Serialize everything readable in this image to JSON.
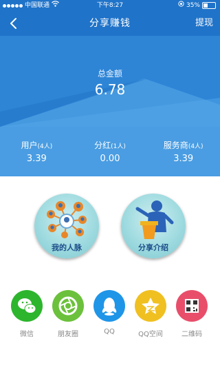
{
  "status_bar": {
    "carrier": "中国联通",
    "time": "下午8:27",
    "battery": "35%",
    "battery_level": 0.35
  },
  "nav": {
    "title": "分享赚钱",
    "right_action": "提现",
    "back_icon": "chevron-left-icon"
  },
  "summary": {
    "label": "总金额",
    "value": "6.78"
  },
  "stats": [
    {
      "name": "用户",
      "count": "(4人)",
      "value": "3.39"
    },
    {
      "name": "分红",
      "count": "(1人)",
      "value": "0.00"
    },
    {
      "name": "服务商",
      "count": "(4人)",
      "value": "3.39"
    }
  ],
  "actions": [
    {
      "label": "我的人脉",
      "icon": "network-people-icon"
    },
    {
      "label": "分享介绍",
      "icon": "presenter-icon"
    }
  ],
  "share_targets": [
    {
      "label": "微信",
      "icon": "wechat-icon",
      "color": "#2db52d"
    },
    {
      "label": "朋友圈",
      "icon": "moments-icon",
      "color": "#6cc13c"
    },
    {
      "label": "QQ",
      "icon": "qq-icon",
      "color": "#1f95e8"
    },
    {
      "label": "QQ空间",
      "icon": "qzone-icon",
      "color": "#f0c021"
    },
    {
      "label": "二维码",
      "icon": "qrcode-icon",
      "color": "#e84e6a"
    }
  ],
  "colors": {
    "nav": "#1f73c9",
    "hero": "#3f95df",
    "stats": "#4a9de2"
  }
}
